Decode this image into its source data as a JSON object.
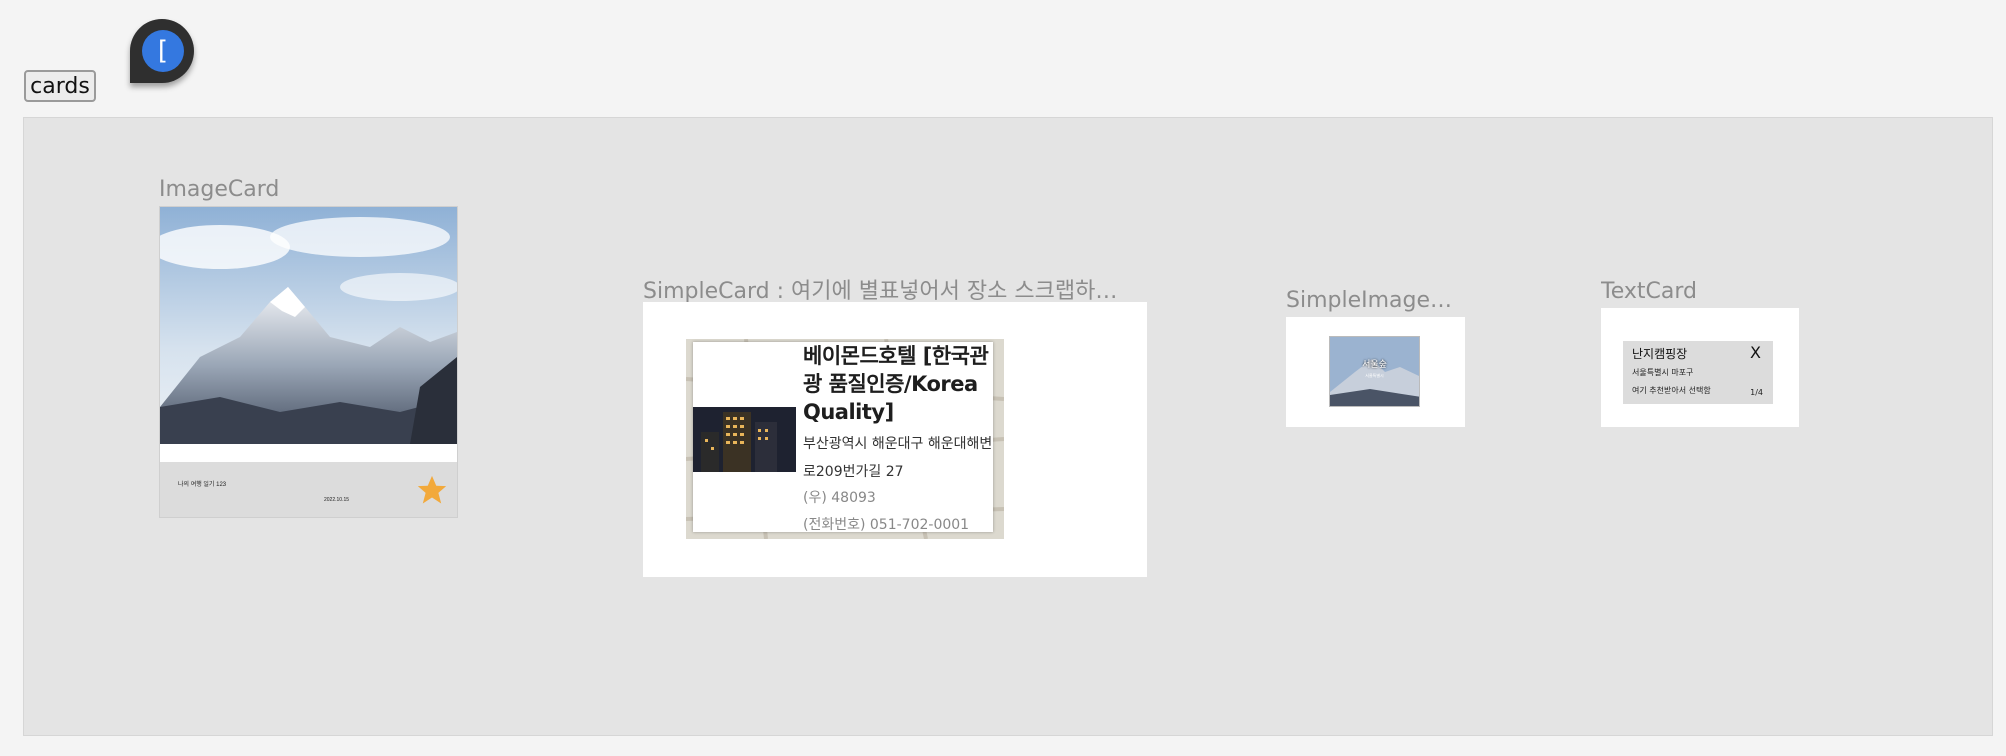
{
  "toolbar": {
    "cards_button_label": "cards",
    "fab_glyph": "["
  },
  "frames": {
    "image_card": {
      "label": "ImageCard",
      "footer_text": "나의 여행 일기 123",
      "footer_date": "2022.10.15",
      "star_color": "#f2a93b"
    },
    "simple_card": {
      "label": "SimpleCard : 여기에 별표넣어서 장소 스크랩하도록...",
      "title": "베이몬드호텔 [한국관광 품질인증/Korea Quality]",
      "address": "부산광역시 해운대구 해운대해변로209번가길 27",
      "zip": "(우) 48093",
      "tel": "(전화번호) 051-702-0001"
    },
    "simple_image_card": {
      "label": "SimpleImageC...",
      "overlay_title": "서울숲",
      "overlay_sub": "서울특별시"
    },
    "text_card": {
      "label": "TextCard",
      "title": "난지캠핑장",
      "close": "X",
      "address": "서울특별시 마포구",
      "description": "여기 추천받아서 선택함",
      "page": "1/4"
    }
  },
  "colors": {
    "page_bg": "#f4f4f4",
    "canvas_bg": "#e4e4e4",
    "fab_blue": "#3478e0",
    "label_gray": "#8c8c8c"
  }
}
